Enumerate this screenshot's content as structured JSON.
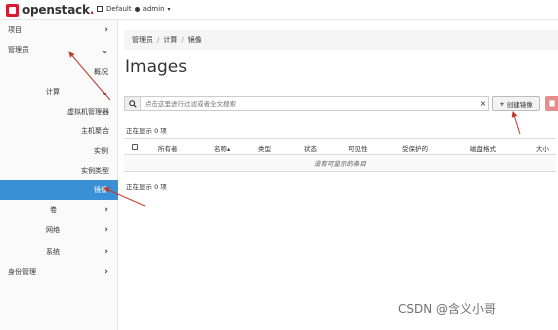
{
  "header": {
    "brand": "openstack",
    "brand_dot": ".",
    "project": "Default",
    "user": "admin"
  },
  "sidebar": {
    "items": [
      {
        "label": "项目",
        "chevron": "›"
      },
      {
        "label": "管理员",
        "chevron": "⌄"
      },
      {
        "label": "概况"
      },
      {
        "label": "计算",
        "chevron": "⌄"
      },
      {
        "label": "虚拟机管理器"
      },
      {
        "label": "主机聚合"
      },
      {
        "label": "实例"
      },
      {
        "label": "实例类型"
      },
      {
        "label": "镜像",
        "chevron": "›"
      },
      {
        "label": "卷",
        "chevron": "›"
      },
      {
        "label": "网络",
        "chevron": "›"
      },
      {
        "label": "系统",
        "chevron": "›"
      },
      {
        "label": "身份管理",
        "chevron": "›"
      }
    ]
  },
  "breadcrumb": {
    "items": [
      "管理员",
      "计算",
      "镜像"
    ],
    "separator": "/"
  },
  "page": {
    "title": "Images"
  },
  "toolbar": {
    "search_placeholder": "点击这里进行过滤或者全文搜索",
    "clear": "×",
    "create_label": "创建镜像",
    "create_icon": "+"
  },
  "table": {
    "count_top": "正在显示 0 项",
    "count_bottom": "正在显示 0 项",
    "columns": [
      "所有者",
      "名称",
      "类型",
      "状态",
      "可见性",
      "受保护的",
      "磁盘格式",
      "大小"
    ],
    "sort_indicator": "▴",
    "empty_message": "没有可显示的条目"
  },
  "watermark": "CSDN @含义小哥",
  "colors": {
    "brand": "#da1a32",
    "active": "#3b8fd5",
    "danger": "#e58e8e",
    "annotation": "#c0392b"
  }
}
